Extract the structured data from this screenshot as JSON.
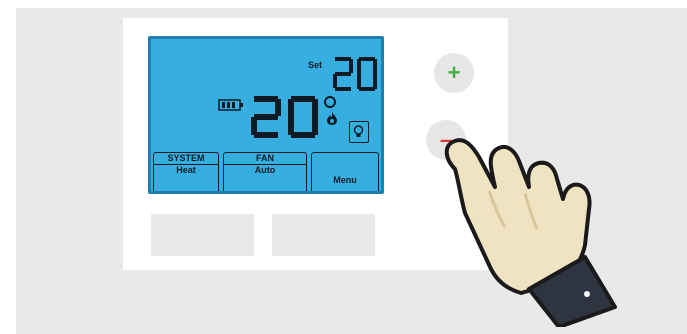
{
  "thermostat": {
    "set_label": "Set",
    "set_temperature": "20",
    "current_temperature": "20",
    "system": {
      "label": "SYSTEM",
      "value": "Heat"
    },
    "fan": {
      "label": "FAN",
      "value": "Auto"
    },
    "menu_label": "Menu",
    "plus_label": "+",
    "minus_label": "–"
  },
  "colors": {
    "screen": "#37aee0",
    "screen_border": "#1f7fae",
    "plus": "#3fae3c",
    "minus": "#d63a3a",
    "hand": "#efe3c2",
    "cuff": "#2f3540"
  },
  "icons": [
    "battery-icon",
    "flame-icon",
    "bulb-icon",
    "pointing-hand-icon"
  ]
}
